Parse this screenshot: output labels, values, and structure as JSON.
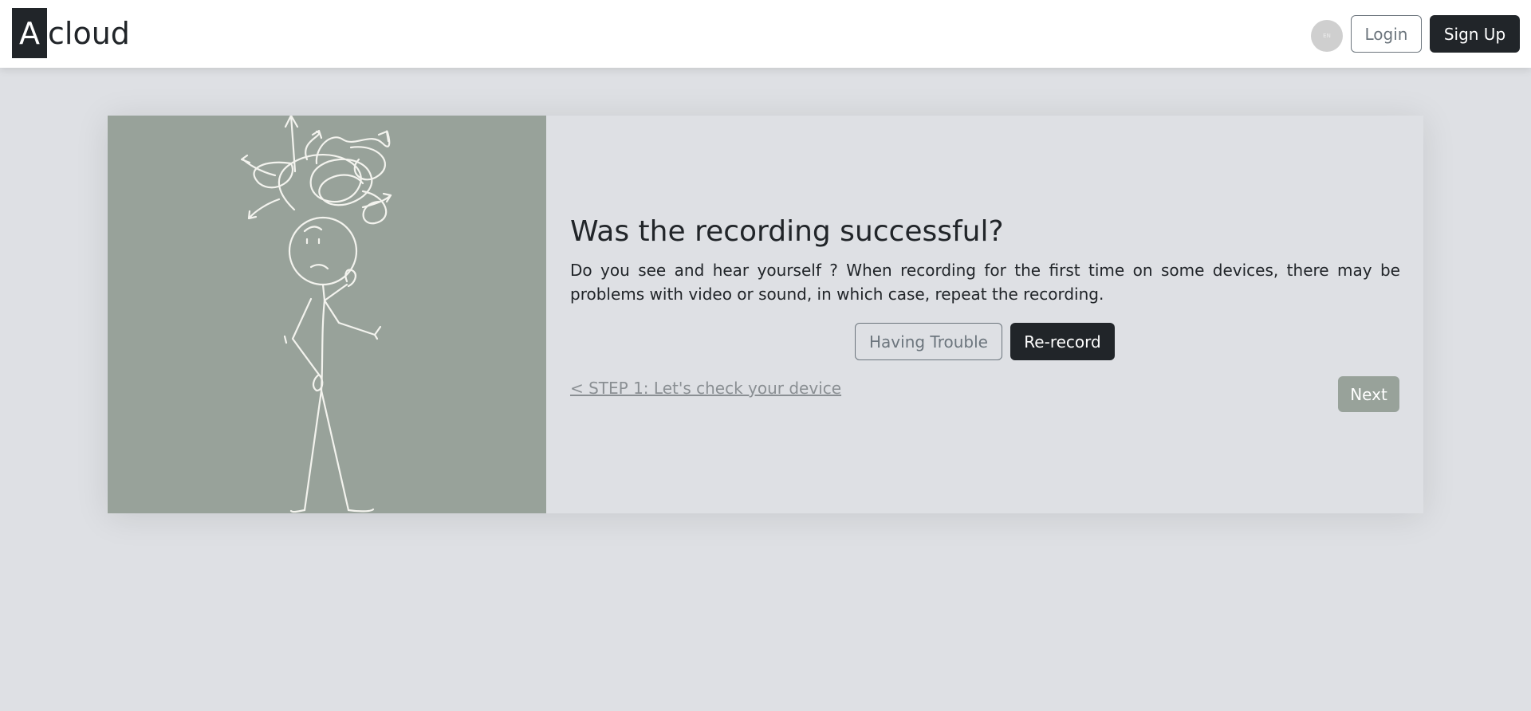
{
  "header": {
    "brand_mark": "A",
    "brand_rest": "cloud",
    "language_badge": "EN",
    "login_label": "Login",
    "signup_label": "Sign Up"
  },
  "recording_check": {
    "title": "Was the recording successful?",
    "description": "Do you see and hear yourself ? When recording for the first time on some devices, there may be problems with video or sound, in which case, repeat the recording.",
    "having_trouble_label": "Having Trouble",
    "rerecord_label": "Re-record",
    "back_step_label": "< STEP 1: Let's check your device",
    "next_label": "Next"
  },
  "colors": {
    "dark": "#212529",
    "sage": "#98a29a",
    "background": "#dee0e4",
    "muted": "#6c757d"
  }
}
